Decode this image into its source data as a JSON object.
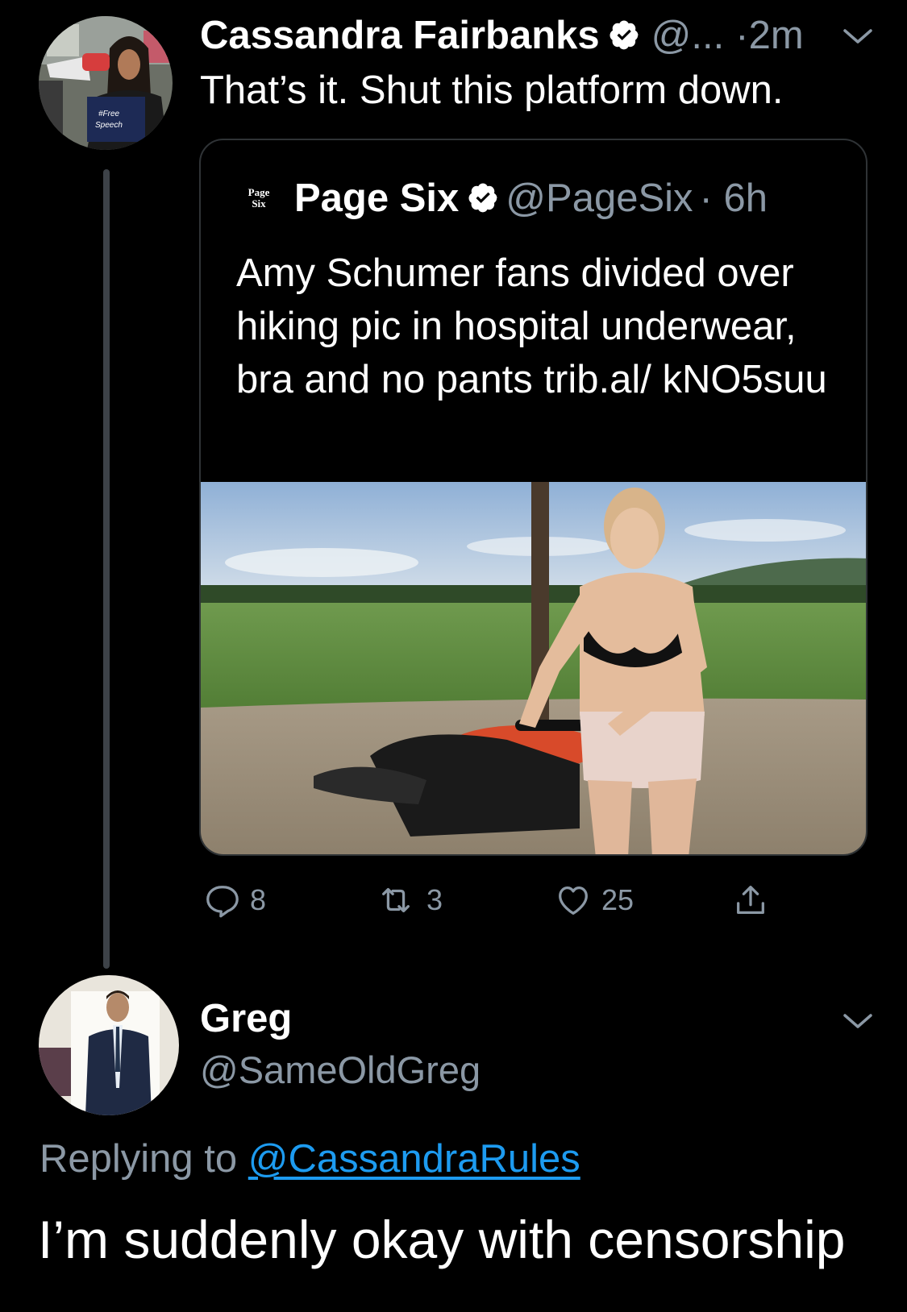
{
  "tweet": {
    "author_name": "Cassandra Fairbanks",
    "author_handle": "@...",
    "time": "·2m",
    "text": "That’s it. Shut this platform down.",
    "quoted": {
      "logo_text": "Page Six",
      "author_name": "Page Six",
      "author_handle": "@PageSix",
      "time": "· 6h",
      "text": "Amy Schumer fans divided over hiking pic in hospital underwear, bra and no pants trib.al/ kNO5suu"
    },
    "actions": {
      "replies": "8",
      "retweets": "3",
      "likes": "25"
    }
  },
  "reply": {
    "author_name": "Greg",
    "author_handle": "@SameOldGreg",
    "replying_prefix": "Replying to",
    "replying_to": "@CassandraRules",
    "text": "I’m suddenly okay with censorship"
  },
  "icons": [
    "verified-icon",
    "chevron-down-icon",
    "reply-icon",
    "retweet-icon",
    "like-icon",
    "share-icon"
  ],
  "colors": {
    "background": "#000000",
    "secondary_text": "#8b98a5",
    "link": "#1d9bf0",
    "verified": "#ffffff",
    "border": "#2f3336"
  }
}
